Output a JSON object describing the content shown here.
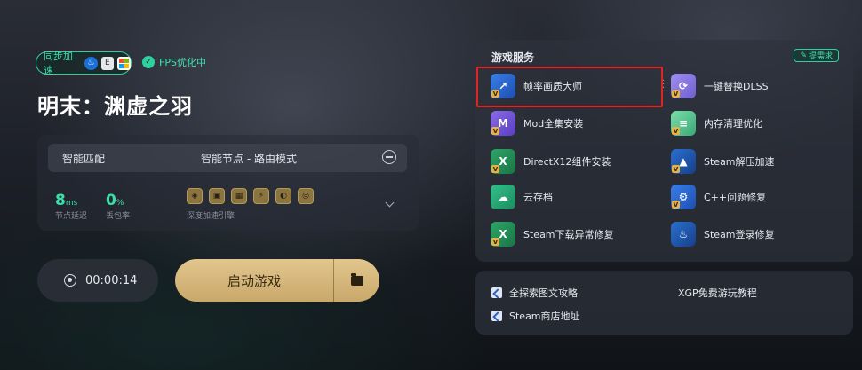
{
  "accel": {
    "label": "同步加速",
    "platforms": [
      {
        "name": "steam-icon",
        "color": "#1b6fd6"
      },
      {
        "name": "epic-icon",
        "color": "#e5e7ea"
      },
      {
        "name": "microsoft-icon",
        "color": "#ffffff"
      }
    ]
  },
  "fps": {
    "label": "FPS优化中"
  },
  "game": {
    "title": "明末：渊虚之羽"
  },
  "network": {
    "mode": "智能匹配",
    "node": "智能节点 - 路由模式",
    "latency": {
      "value": "8",
      "unit": "ms",
      "label": "节点延迟"
    },
    "loss": {
      "value": "0",
      "unit": "%",
      "label": "丢包率"
    },
    "engine_label": "深度加速引擎"
  },
  "controls": {
    "timer": "00:00:14",
    "start_label": "启动游戏"
  },
  "services": {
    "title": "游戏服务",
    "request_label": "提需求",
    "items": [
      {
        "label": "帧率画质大师",
        "icon": "frame-quality-icon"
      },
      {
        "label": "一键替换DLSS",
        "icon": "dlss-icon"
      },
      {
        "label": "Mod全集安装",
        "icon": "mod-icon"
      },
      {
        "label": "内存清理优化",
        "icon": "memory-icon"
      },
      {
        "label": "DirectX12组件安装",
        "icon": "directx-icon"
      },
      {
        "label": "Steam解压加速",
        "icon": "steam-unzip-icon"
      },
      {
        "label": "云存档",
        "icon": "cloud-save-icon"
      },
      {
        "label": "C++问题修复",
        "icon": "cpp-fix-icon"
      },
      {
        "label": "Steam下载异常修复",
        "icon": "steam-download-icon"
      },
      {
        "label": "Steam登录修复",
        "icon": "steam-login-icon"
      }
    ]
  },
  "guides": [
    {
      "label": "全探索图文攻略"
    },
    {
      "label": "XGP免费游玩教程"
    },
    {
      "label": "Steam商店地址"
    }
  ]
}
